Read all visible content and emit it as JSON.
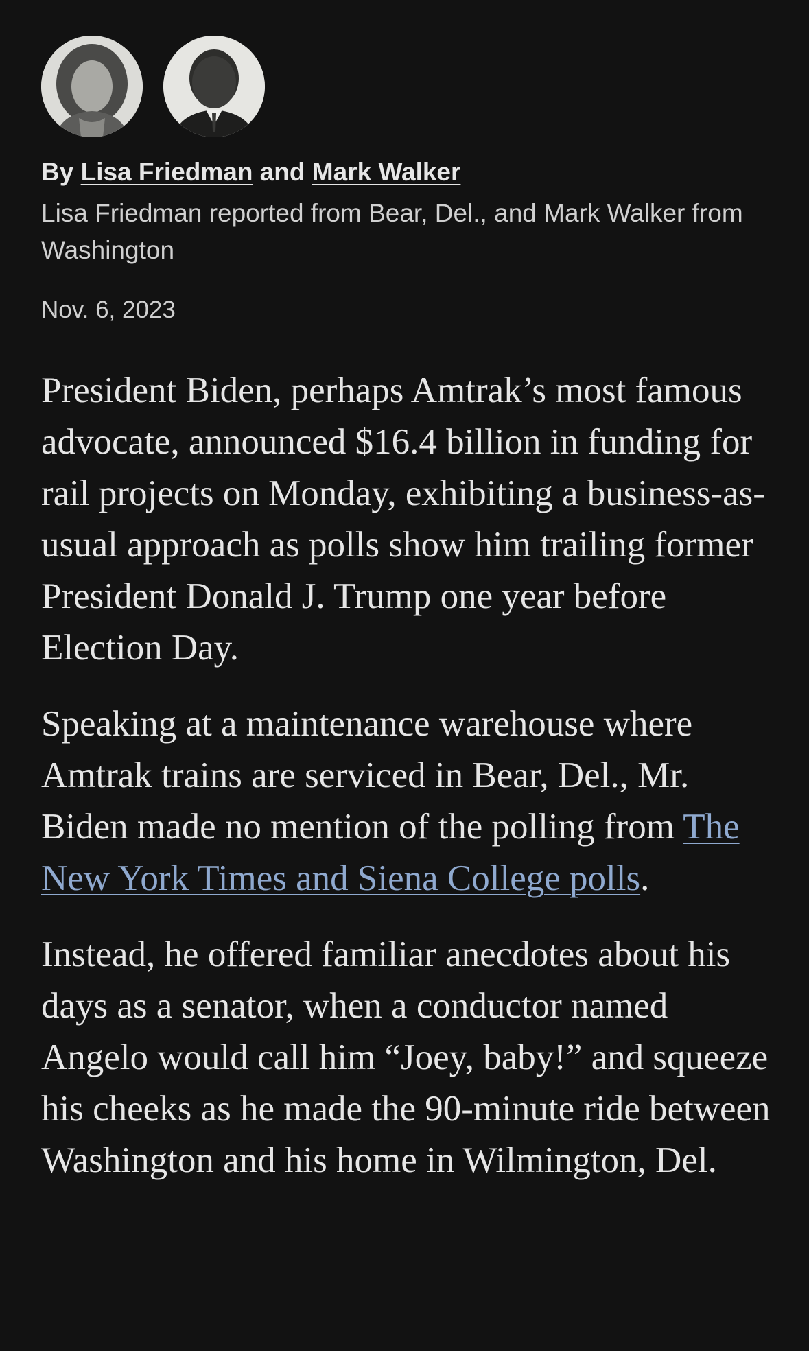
{
  "byline": {
    "prefix": "By",
    "author1": "Lisa Friedman",
    "conjunction": "and",
    "author2": "Mark Walker"
  },
  "dateline": "Lisa Friedman reported from Bear, Del., and Mark Walker from Washington",
  "published_date": "Nov. 6, 2023",
  "article": {
    "p1": "President Biden, perhaps Amtrak’s most famous advocate, announced $16.4 billion in funding for rail projects on Monday, exhibiting a business-as-usual approach as polls show him trailing former President Donald J. Trump one year before Election Day.",
    "p2_before_link": "Speaking at a maintenance warehouse where Amtrak trains are serviced in Bear, Del., Mr. Biden made no mention of the polling from ",
    "p2_link": "The New York Times and Siena College polls",
    "p2_after_link": ".",
    "p3": "Instead, he offered familiar anecdotes about his days as a senator, when a conductor named Angelo would call him “Joey, baby!” and squeeze his cheeks as he made the 90-minute ride between Washington and his home in Wilmington, Del."
  },
  "colors": {
    "background": "#121212",
    "text": "#e6e6e6",
    "link": "#8fa9cf"
  }
}
